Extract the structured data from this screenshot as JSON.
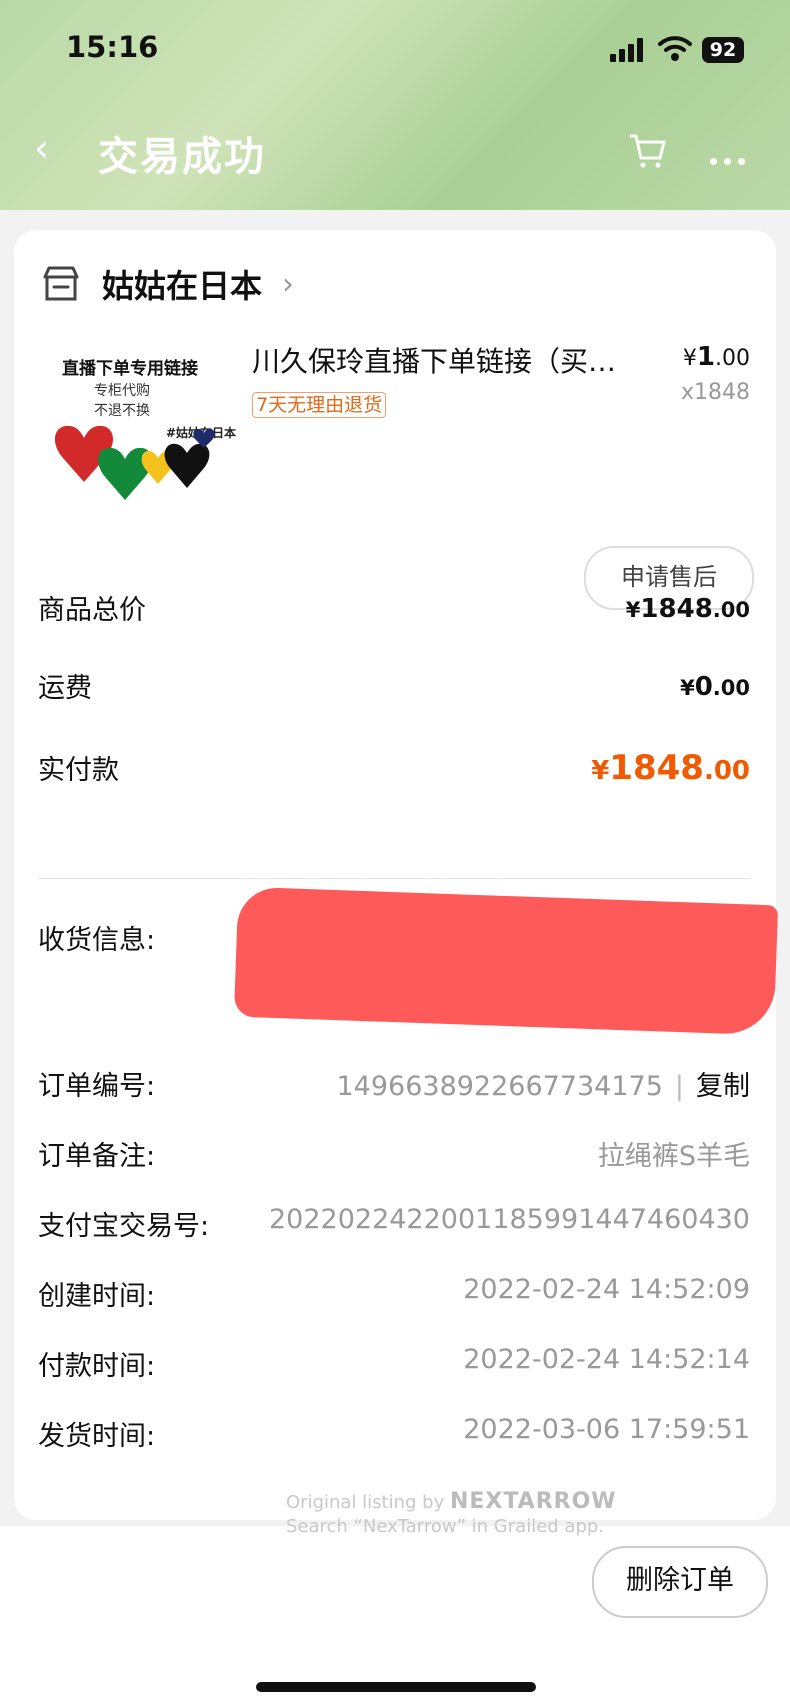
{
  "status_bar": {
    "time": "15:16",
    "battery": "92"
  },
  "nav": {
    "back_icon": "‹",
    "title": "交易成功",
    "cart_icon": "cart-icon",
    "more_icon": "more-icon"
  },
  "shop": {
    "name": "姑姑在日本",
    "chevron": "›"
  },
  "product": {
    "image_text": {
      "line1": "直播下单专用链接",
      "line2": "专柜代购",
      "line3": "不退不换",
      "line4": "#姑姑在日本"
    },
    "title": "川久保玲直播下单链接（买…",
    "price_currency": "¥",
    "price_int": "1",
    "price_dec": ".00",
    "quantity": "x1848",
    "return_tag": "7天无理由退货",
    "after_sale_button": "申请售后"
  },
  "summary": {
    "goods_total_label": "商品总价",
    "goods_total_cur": "¥",
    "goods_total_int": "1848",
    "goods_total_dec": ".00",
    "shipping_label": "运费",
    "shipping_cur": "¥",
    "shipping_int": "0",
    "shipping_dec": ".00",
    "paid_label": "实付款",
    "paid_cur": "¥",
    "paid_int": "1848",
    "paid_dec": ".00"
  },
  "order_info": {
    "address_label": "收货信息:",
    "order_no_label": "订单编号:",
    "order_no": "1496638922667734175",
    "copy_label": "复制",
    "remark_label": "订单备注:",
    "remark": "拉绳裤S羊毛",
    "alipay_label": "支付宝交易号:",
    "alipay_no": "2022022422001185991447460430",
    "created_label": "创建时间:",
    "created_time": "2022-02-24 14:52:09",
    "paid_time_label": "付款时间:",
    "paid_time": "2022-02-24 14:52:14",
    "ship_time_label": "发货时间:",
    "ship_time": "2022-03-06 17:59:51"
  },
  "watermark": {
    "line1": "Original listing by",
    "brand": "NEXTARROW",
    "line2": "Search “NexTarrow” in Grailed app."
  },
  "bottom": {
    "delete_button": "删除订单"
  },
  "colors": {
    "accent": "#f05a00",
    "header_green": "#b9d9a6",
    "redaction": "#ff5a5a"
  }
}
